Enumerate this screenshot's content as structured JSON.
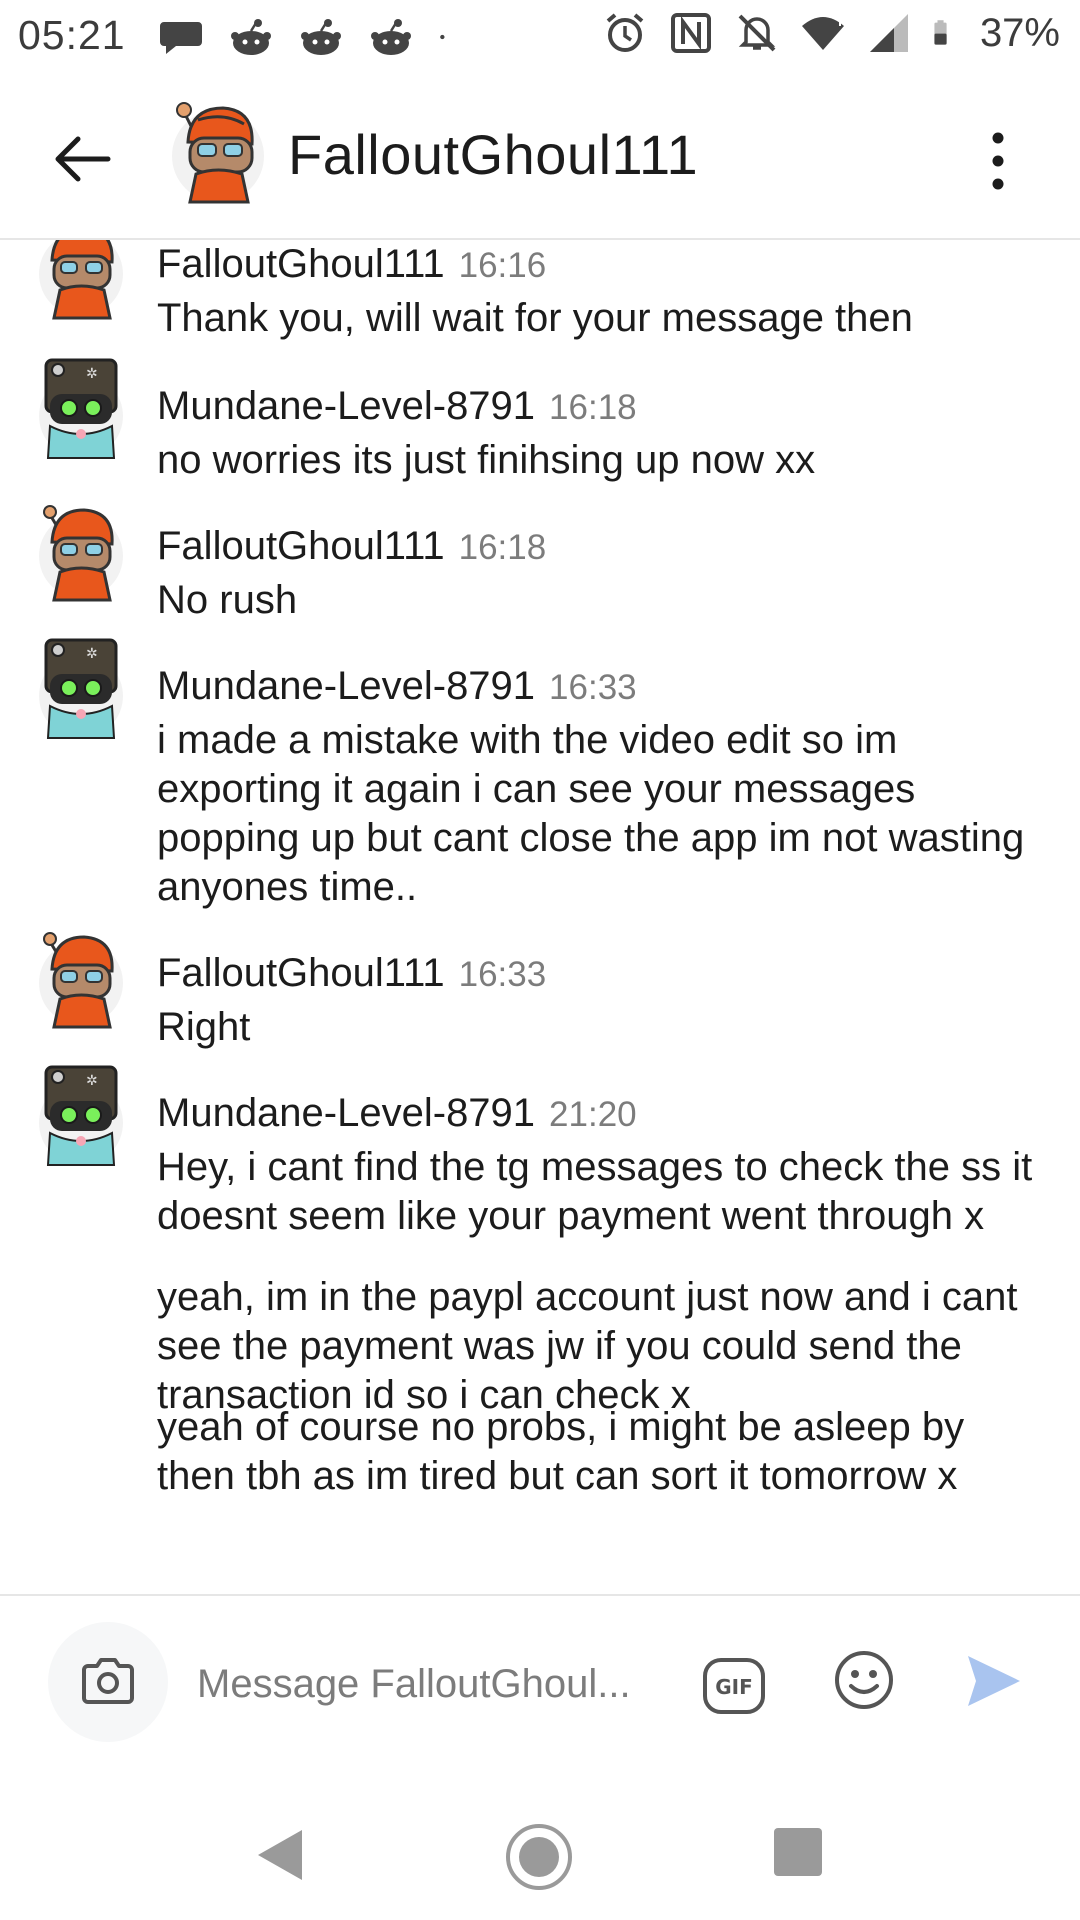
{
  "status_bar": {
    "time": "05:21",
    "battery": "37%",
    "notification_icons": [
      "chat-bubble-icon",
      "reddit-snoo-icon",
      "reddit-snoo-icon",
      "reddit-snoo-icon",
      "more-dot-icon"
    ],
    "system_icons": [
      "alarm-icon",
      "nfc-icon",
      "mute-icon",
      "wifi-icon",
      "signal-icon",
      "battery-icon"
    ]
  },
  "header": {
    "title": "FalloutGhoul111",
    "back_icon": "arrow-left-icon",
    "more_icon": "more-vertical-icon"
  },
  "colors": {
    "text": "#1c1c1c",
    "timestamp": "#7c7c7c",
    "send_accent": "#a9c4ef",
    "divider": "#e6e6e6",
    "fallout_avatar": "#e8571c",
    "mundane_avatar": "#4a4337"
  },
  "messages": [
    {
      "author": "FalloutGhoul111",
      "time": "16:16",
      "avatar": "fallout",
      "lines": [
        "Thank you, will wait for your message then"
      ]
    },
    {
      "author": "Mundane-Level-8791",
      "time": "16:18",
      "avatar": "mundane",
      "lines": [
        "no worries its just finihsing up now xx"
      ]
    },
    {
      "author": "FalloutGhoul111",
      "time": "16:18",
      "avatar": "fallout",
      "lines": [
        "No rush"
      ]
    },
    {
      "author": "Mundane-Level-8791",
      "time": "16:33",
      "avatar": "mundane",
      "lines": [
        "i made a mistake with the video edit so im exporting it again i can see your messages popping up but cant close the app im not wasting anyones time.."
      ]
    },
    {
      "author": "FalloutGhoul111",
      "time": "16:33",
      "avatar": "fallout",
      "lines": [
        "Right"
      ]
    },
    {
      "author": "Mundane-Level-8791",
      "time": "21:20",
      "avatar": "mundane",
      "lines": [
        "Hey, i cant find the tg messages to check the ss it doesnt seem like your payment went through x",
        "yeah, im in the paypl account just now and i cant see the payment was jw if you could send the transaction id so i can check x",
        "yeah of course no probs, i might be asleep by then tbh as im tired but can sort it tomorrow x"
      ]
    }
  ],
  "composer": {
    "placeholder": "Message FalloutGhoul...",
    "camera_icon": "camera-icon",
    "gif_icon": "gif-icon",
    "emoji_icon": "emoji-icon",
    "send_icon": "send-icon"
  },
  "navbar": {
    "icons": [
      "nav-back-icon",
      "nav-home-icon",
      "nav-recent-icon"
    ]
  }
}
